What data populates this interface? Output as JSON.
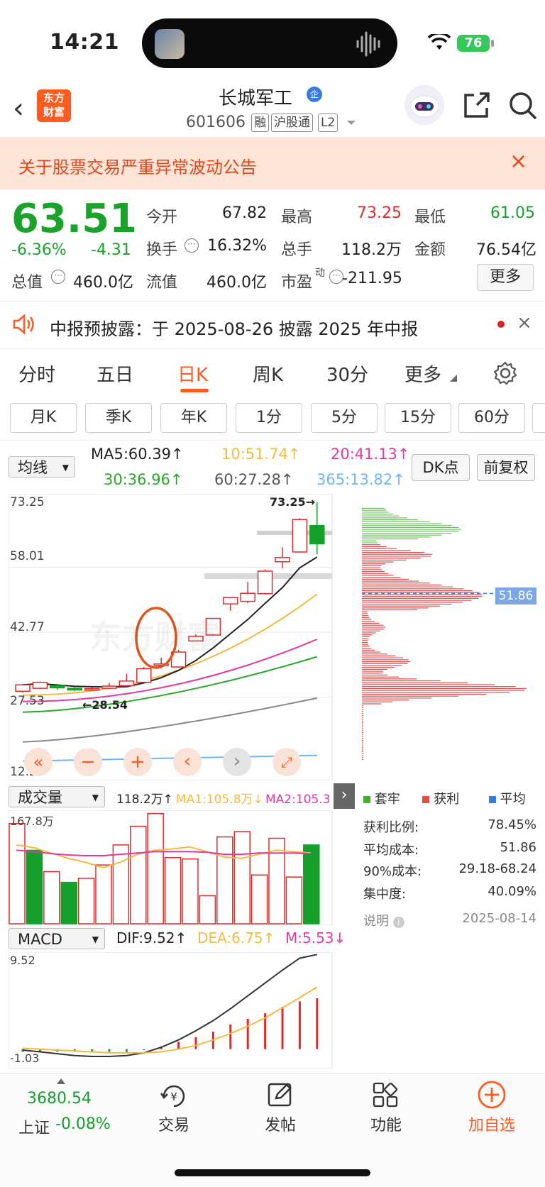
{
  "status": {
    "time": "14:21",
    "battery": "76"
  },
  "header": {
    "logo_line1": "东方",
    "logo_line2": "财富",
    "title": "长城军工",
    "title_badge": "企",
    "code": "601606",
    "tags": [
      "融",
      "沪股通",
      "L2"
    ]
  },
  "notice": {
    "text": "关于股票交易严重异常波动公告",
    "close": "×"
  },
  "quote": {
    "price": "63.51",
    "change_pct": "-6.36%",
    "change": "-4.31",
    "open_label": "今开",
    "open": "67.82",
    "high_label": "最高",
    "high": "73.25",
    "low_label": "最低",
    "low": "61.05",
    "turnover_label": "换手",
    "turnover": "16.32%",
    "volume_label": "总手",
    "volume": "118.2万",
    "amount_label": "金额",
    "amount": "76.54亿",
    "mktcap_label": "总值",
    "mktcap": "460.0亿",
    "float_label": "流值",
    "float": "460.0亿",
    "pe_label": "市盈",
    "pe_sup": "动",
    "pe": "-211.95",
    "more": "更多"
  },
  "disclosure": {
    "text": "中报预披露：于 2025-08-26 披露 2025 年中报",
    "close": "×"
  },
  "tabs": [
    {
      "label": "分时"
    },
    {
      "label": "五日"
    },
    {
      "label": "日K"
    },
    {
      "label": "周K"
    },
    {
      "label": "30分"
    },
    {
      "label": "更多"
    }
  ],
  "periods": [
    {
      "label": "月K"
    },
    {
      "label": "季K"
    },
    {
      "label": "年K"
    },
    {
      "label": "1分"
    },
    {
      "label": "5分"
    },
    {
      "label": "15分"
    },
    {
      "label": "60分"
    }
  ],
  "ma": {
    "selector": "均线",
    "ma5": "MA5:60.39↑",
    "ma10": "10:51.74↑",
    "ma20": "20:41.13↑",
    "ma30": "30:36.96↑",
    "ma60": "60:27.28↑",
    "ma365": "365:13.82↑",
    "colors": {
      "ma5": "#222222",
      "ma10": "#f5b942",
      "ma20": "#e03aa0",
      "ma30": "#2aa82a",
      "ma60": "#888888",
      "ma365": "#6ab7ff"
    },
    "dk_button": "DK点",
    "adjust_button": "前复权"
  },
  "kchart": {
    "y_labels": [
      "73.25",
      "58.01",
      "42.77",
      "27.53",
      "12.29"
    ],
    "max_label": "73.25→",
    "min_label": "←28.54",
    "cost_label": "51.86",
    "watermark": "东方财富"
  },
  "chart_data": {
    "type": "candlestick",
    "ylim": [
      12.29,
      73.25
    ],
    "candles": [
      {
        "o": 28.9,
        "c": 30.4,
        "h": 30.6,
        "l": 28.6
      },
      {
        "o": 29.6,
        "c": 31.0,
        "h": 31.2,
        "l": 29.4
      },
      {
        "o": 30.2,
        "c": 29.7,
        "h": 30.6,
        "l": 29.3
      },
      {
        "o": 29.6,
        "c": 29.2,
        "h": 29.9,
        "l": 28.9
      },
      {
        "o": 29.3,
        "c": 29.5,
        "h": 29.8,
        "l": 29.0
      },
      {
        "o": 29.6,
        "c": 30.1,
        "h": 30.9,
        "l": 29.4
      },
      {
        "o": 30.2,
        "c": 31.3,
        "h": 33.0,
        "l": 30.0
      },
      {
        "o": 31.0,
        "c": 34.2,
        "h": 34.6,
        "l": 30.9
      },
      {
        "o": 35.0,
        "c": 35.3,
        "h": 36.8,
        "l": 34.3
      },
      {
        "o": 34.6,
        "c": 38.1,
        "h": 38.6,
        "l": 34.4
      },
      {
        "o": 40.7,
        "c": 41.8,
        "h": 42.2,
        "l": 40.6
      },
      {
        "o": 42.1,
        "c": 46.0,
        "h": 46.0,
        "l": 41.9
      },
      {
        "o": 49.4,
        "c": 50.9,
        "h": 51.0,
        "l": 47.8
      },
      {
        "o": 50.0,
        "c": 51.9,
        "h": 54.6,
        "l": 49.6
      },
      {
        "o": 51.8,
        "c": 57.1,
        "h": 57.5,
        "l": 51.6
      },
      {
        "o": 59.3,
        "c": 60.3,
        "h": 62.7,
        "l": 57.8
      },
      {
        "o": 61.6,
        "c": 69.2,
        "h": 69.5,
        "l": 61.5
      },
      {
        "o": 67.82,
        "c": 63.51,
        "h": 73.25,
        "l": 61.05
      }
    ],
    "volume": {
      "label": "成交量",
      "current": "118.2万↑",
      "ma1": "MA1:105.8万↓",
      "ma2": "MA2:105.3万↓",
      "max_label": "167.8万",
      "values": [
        150,
        110,
        78,
        62,
        68,
        88,
        118,
        146,
        165,
        99,
        97,
        42,
        130,
        138,
        73,
        128,
        70,
        118
      ],
      "up": [
        true,
        false,
        true,
        false,
        true,
        true,
        true,
        true,
        true,
        true,
        true,
        true,
        true,
        true,
        true,
        true,
        true,
        false
      ]
    },
    "macd": {
      "label": "MACD",
      "dif": "DIF:9.52↑",
      "dea": "DEA:6.75↑",
      "m": "M:5.53↓",
      "ymax_label": "9.52",
      "ymin_label": "-1.03",
      "dif_values": [
        -0.1,
        -0.3,
        -0.5,
        -0.7,
        -0.8,
        -0.8,
        -0.7,
        -0.4,
        0.2,
        1.0,
        2.0,
        3.1,
        4.4,
        5.8,
        7.2,
        8.6,
        9.9,
        10.3
      ],
      "dea_values": [
        0.1,
        0.0,
        -0.1,
        -0.2,
        -0.3,
        -0.4,
        -0.4,
        -0.4,
        -0.3,
        0.0,
        0.4,
        1.0,
        1.7,
        2.5,
        3.4,
        4.5,
        5.6,
        6.75
      ],
      "m_values": [
        -0.3,
        -0.3,
        -0.3,
        -0.3,
        -0.3,
        -0.3,
        -0.3,
        -0.1,
        0.3,
        0.8,
        1.3,
        1.9,
        2.7,
        3.3,
        3.9,
        4.6,
        5.2,
        5.53
      ]
    }
  },
  "chips": {
    "legend": [
      "套牢",
      "获利",
      "平均"
    ],
    "legend_colors": [
      "#43b02a",
      "#e84a4a",
      "#3a7be0"
    ],
    "rows": [
      {
        "label": "获利比例:",
        "value": "78.45%"
      },
      {
        "label": "平均成本:",
        "value": "51.86"
      },
      {
        "label": "90%成本:",
        "value": "29.18-68.24"
      },
      {
        "label": "集中度:",
        "value": "40.09%"
      }
    ],
    "note": "说明",
    "date": "2025-08-14"
  },
  "bottom": {
    "index_value": "3680.54",
    "index_name": "上证",
    "index_change": "-0.08%",
    "trade": "交易",
    "post": "发帖",
    "func": "功能",
    "add": "加自选"
  },
  "colors": {
    "up": "#e02a2a",
    "down": "#14a02a",
    "accent": "#ff5a1f"
  }
}
